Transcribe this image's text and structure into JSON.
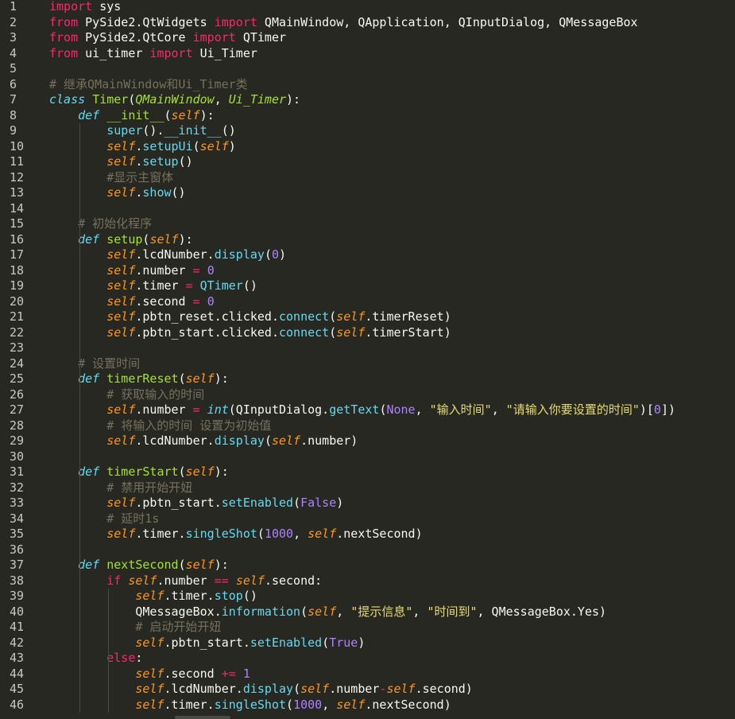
{
  "editor": {
    "theme_colors": {
      "background": "#272822",
      "keyword": "#f92672",
      "function": "#a6e22e",
      "builtin": "#66d9ef",
      "self": "#fd971f",
      "number": "#ae81ff",
      "string": "#e6db74",
      "comment": "#75715e"
    },
    "lines": [
      {
        "n": "1",
        "tokens": [
          [
            "kw",
            "import"
          ],
          [
            "plain",
            " sys"
          ]
        ]
      },
      {
        "n": "2",
        "tokens": [
          [
            "kw",
            "from"
          ],
          [
            "plain",
            " PySide2.QtWidgets "
          ],
          [
            "kw",
            "import"
          ],
          [
            "plain",
            " QMainWindow, QApplication, QInputDialog, QMessageBox"
          ]
        ]
      },
      {
        "n": "3",
        "tokens": [
          [
            "kw",
            "from"
          ],
          [
            "plain",
            " PySide2.QtCore "
          ],
          [
            "kw",
            "import"
          ],
          [
            "plain",
            " QTimer"
          ]
        ]
      },
      {
        "n": "4",
        "tokens": [
          [
            "kw",
            "from"
          ],
          [
            "plain",
            " ui_timer "
          ],
          [
            "kw",
            "import"
          ],
          [
            "plain",
            " Ui_Timer"
          ]
        ]
      },
      {
        "n": "5",
        "tokens": []
      },
      {
        "n": "6",
        "tokens": [
          [
            "cmt",
            "# 继承QMainWindow和Ui_Timer类"
          ]
        ]
      },
      {
        "n": "7",
        "tokens": [
          [
            "def",
            "class"
          ],
          [
            "plain",
            " "
          ],
          [
            "fn",
            "Timer"
          ],
          [
            "plain",
            "("
          ],
          [
            "inh",
            "QMainWindow"
          ],
          [
            "plain",
            ", "
          ],
          [
            "inh",
            "Ui_Timer"
          ],
          [
            "plain",
            "):"
          ]
        ]
      },
      {
        "n": "8",
        "tokens": [
          [
            "plain",
            "    "
          ],
          [
            "def",
            "def"
          ],
          [
            "plain",
            " "
          ],
          [
            "fn",
            "__init__"
          ],
          [
            "plain",
            "("
          ],
          [
            "arg",
            "self"
          ],
          [
            "plain",
            "):"
          ]
        ]
      },
      {
        "n": "9",
        "tokens": [
          [
            "plain",
            "        "
          ],
          [
            "call",
            "super"
          ],
          [
            "plain",
            "()."
          ],
          [
            "call",
            "__init__"
          ],
          [
            "plain",
            "()"
          ]
        ]
      },
      {
        "n": "10",
        "tokens": [
          [
            "plain",
            "        "
          ],
          [
            "self",
            "self"
          ],
          [
            "plain",
            "."
          ],
          [
            "call",
            "setupUi"
          ],
          [
            "plain",
            "("
          ],
          [
            "self",
            "self"
          ],
          [
            "plain",
            ")"
          ]
        ]
      },
      {
        "n": "11",
        "tokens": [
          [
            "plain",
            "        "
          ],
          [
            "self",
            "self"
          ],
          [
            "plain",
            "."
          ],
          [
            "call",
            "setup"
          ],
          [
            "plain",
            "()"
          ]
        ]
      },
      {
        "n": "12",
        "tokens": [
          [
            "plain",
            "        "
          ],
          [
            "cmt",
            "#显示主窗体"
          ]
        ]
      },
      {
        "n": "13",
        "tokens": [
          [
            "plain",
            "        "
          ],
          [
            "self",
            "self"
          ],
          [
            "plain",
            "."
          ],
          [
            "call",
            "show"
          ],
          [
            "plain",
            "()"
          ]
        ]
      },
      {
        "n": "14",
        "tokens": []
      },
      {
        "n": "15",
        "tokens": [
          [
            "plain",
            "    "
          ],
          [
            "cmt",
            "# 初始化程序"
          ]
        ]
      },
      {
        "n": "16",
        "tokens": [
          [
            "plain",
            "    "
          ],
          [
            "def",
            "def"
          ],
          [
            "plain",
            " "
          ],
          [
            "fn",
            "setup"
          ],
          [
            "plain",
            "("
          ],
          [
            "arg",
            "self"
          ],
          [
            "plain",
            "):"
          ]
        ]
      },
      {
        "n": "17",
        "tokens": [
          [
            "plain",
            "        "
          ],
          [
            "self",
            "self"
          ],
          [
            "plain",
            ".lcdNumber."
          ],
          [
            "call",
            "display"
          ],
          [
            "plain",
            "("
          ],
          [
            "num",
            "0"
          ],
          [
            "plain",
            ")"
          ]
        ]
      },
      {
        "n": "18",
        "tokens": [
          [
            "plain",
            "        "
          ],
          [
            "self",
            "self"
          ],
          [
            "plain",
            ".number "
          ],
          [
            "op",
            "="
          ],
          [
            "plain",
            " "
          ],
          [
            "num",
            "0"
          ]
        ]
      },
      {
        "n": "19",
        "tokens": [
          [
            "plain",
            "        "
          ],
          [
            "self",
            "self"
          ],
          [
            "plain",
            ".timer "
          ],
          [
            "op",
            "="
          ],
          [
            "plain",
            " "
          ],
          [
            "call",
            "QTimer"
          ],
          [
            "plain",
            "()"
          ]
        ]
      },
      {
        "n": "20",
        "tokens": [
          [
            "plain",
            "        "
          ],
          [
            "self",
            "self"
          ],
          [
            "plain",
            ".second "
          ],
          [
            "op",
            "="
          ],
          [
            "plain",
            " "
          ],
          [
            "num",
            "0"
          ]
        ]
      },
      {
        "n": "21",
        "tokens": [
          [
            "plain",
            "        "
          ],
          [
            "self",
            "self"
          ],
          [
            "plain",
            ".pbtn_reset.clicked."
          ],
          [
            "call",
            "connect"
          ],
          [
            "plain",
            "("
          ],
          [
            "self",
            "self"
          ],
          [
            "plain",
            ".timerReset)"
          ]
        ]
      },
      {
        "n": "22",
        "tokens": [
          [
            "plain",
            "        "
          ],
          [
            "self",
            "self"
          ],
          [
            "plain",
            ".pbtn_start.clicked."
          ],
          [
            "call",
            "connect"
          ],
          [
            "plain",
            "("
          ],
          [
            "self",
            "self"
          ],
          [
            "plain",
            ".timerStart)"
          ]
        ]
      },
      {
        "n": "23",
        "tokens": []
      },
      {
        "n": "24",
        "tokens": [
          [
            "plain",
            "    "
          ],
          [
            "cmt",
            "# 设置时间"
          ]
        ]
      },
      {
        "n": "25",
        "tokens": [
          [
            "plain",
            "    "
          ],
          [
            "def",
            "def"
          ],
          [
            "plain",
            " "
          ],
          [
            "fn",
            "timerReset"
          ],
          [
            "plain",
            "("
          ],
          [
            "arg",
            "self"
          ],
          [
            "plain",
            "):"
          ]
        ]
      },
      {
        "n": "26",
        "tokens": [
          [
            "plain",
            "        "
          ],
          [
            "cmt",
            "# 获取输入的时间"
          ]
        ]
      },
      {
        "n": "27",
        "tokens": [
          [
            "plain",
            "        "
          ],
          [
            "self",
            "self"
          ],
          [
            "plain",
            ".number "
          ],
          [
            "op",
            "="
          ],
          [
            "plain",
            " "
          ],
          [
            "builtin",
            "int"
          ],
          [
            "plain",
            "(QInputDialog."
          ],
          [
            "call",
            "getText"
          ],
          [
            "plain",
            "("
          ],
          [
            "const",
            "None"
          ],
          [
            "plain",
            ", "
          ],
          [
            "str",
            "\"输入时间\""
          ],
          [
            "plain",
            ", "
          ],
          [
            "str",
            "\"请输入你要设置的时间\""
          ],
          [
            "plain",
            ")["
          ],
          [
            "num",
            "0"
          ],
          [
            "plain",
            "])"
          ]
        ]
      },
      {
        "n": "28",
        "tokens": [
          [
            "plain",
            "        "
          ],
          [
            "cmt",
            "# 将输入的时间 设置为初始值"
          ]
        ]
      },
      {
        "n": "29",
        "tokens": [
          [
            "plain",
            "        "
          ],
          [
            "self",
            "self"
          ],
          [
            "plain",
            ".lcdNumber."
          ],
          [
            "call",
            "display"
          ],
          [
            "plain",
            "("
          ],
          [
            "self",
            "self"
          ],
          [
            "plain",
            ".number)"
          ]
        ]
      },
      {
        "n": "30",
        "tokens": []
      },
      {
        "n": "31",
        "tokens": [
          [
            "plain",
            "    "
          ],
          [
            "def",
            "def"
          ],
          [
            "plain",
            " "
          ],
          [
            "fn",
            "timerStart"
          ],
          [
            "plain",
            "("
          ],
          [
            "arg",
            "self"
          ],
          [
            "plain",
            "):"
          ]
        ]
      },
      {
        "n": "32",
        "tokens": [
          [
            "plain",
            "        "
          ],
          [
            "cmt",
            "# 禁用开始开妞"
          ]
        ]
      },
      {
        "n": "33",
        "tokens": [
          [
            "plain",
            "        "
          ],
          [
            "self",
            "self"
          ],
          [
            "plain",
            ".pbtn_start."
          ],
          [
            "call",
            "setEnabled"
          ],
          [
            "plain",
            "("
          ],
          [
            "const",
            "False"
          ],
          [
            "plain",
            ")"
          ]
        ]
      },
      {
        "n": "34",
        "tokens": [
          [
            "plain",
            "        "
          ],
          [
            "cmt",
            "# 延时1s"
          ]
        ]
      },
      {
        "n": "35",
        "tokens": [
          [
            "plain",
            "        "
          ],
          [
            "self",
            "self"
          ],
          [
            "plain",
            ".timer."
          ],
          [
            "call",
            "singleShot"
          ],
          [
            "plain",
            "("
          ],
          [
            "num",
            "1000"
          ],
          [
            "plain",
            ", "
          ],
          [
            "self",
            "self"
          ],
          [
            "plain",
            ".nextSecond)"
          ]
        ]
      },
      {
        "n": "36",
        "tokens": []
      },
      {
        "n": "37",
        "tokens": [
          [
            "plain",
            "    "
          ],
          [
            "def",
            "def"
          ],
          [
            "plain",
            " "
          ],
          [
            "fn",
            "nextSecond"
          ],
          [
            "plain",
            "("
          ],
          [
            "arg",
            "self"
          ],
          [
            "plain",
            "):"
          ]
        ]
      },
      {
        "n": "38",
        "tokens": [
          [
            "plain",
            "        "
          ],
          [
            "kw",
            "if"
          ],
          [
            "plain",
            " "
          ],
          [
            "self",
            "self"
          ],
          [
            "plain",
            ".number "
          ],
          [
            "op",
            "=="
          ],
          [
            "plain",
            " "
          ],
          [
            "self",
            "self"
          ],
          [
            "plain",
            ".second:"
          ]
        ]
      },
      {
        "n": "39",
        "tokens": [
          [
            "plain",
            "            "
          ],
          [
            "self",
            "self"
          ],
          [
            "plain",
            ".timer."
          ],
          [
            "call",
            "stop"
          ],
          [
            "plain",
            "()"
          ]
        ]
      },
      {
        "n": "40",
        "tokens": [
          [
            "plain",
            "            QMessageBox."
          ],
          [
            "call",
            "information"
          ],
          [
            "plain",
            "("
          ],
          [
            "self",
            "self"
          ],
          [
            "plain",
            ", "
          ],
          [
            "str",
            "\"提示信息\""
          ],
          [
            "plain",
            ", "
          ],
          [
            "str",
            "\"时间到\""
          ],
          [
            "plain",
            ", QMessageBox.Yes)"
          ]
        ]
      },
      {
        "n": "41",
        "tokens": [
          [
            "plain",
            "            "
          ],
          [
            "cmt",
            "# 启动开始开妞"
          ]
        ]
      },
      {
        "n": "42",
        "tokens": [
          [
            "plain",
            "            "
          ],
          [
            "self",
            "self"
          ],
          [
            "plain",
            ".pbtn_start."
          ],
          [
            "call",
            "setEnabled"
          ],
          [
            "plain",
            "("
          ],
          [
            "const",
            "True"
          ],
          [
            "plain",
            ")"
          ]
        ]
      },
      {
        "n": "43",
        "tokens": [
          [
            "plain",
            "        "
          ],
          [
            "kw",
            "else"
          ],
          [
            "plain",
            ":"
          ]
        ]
      },
      {
        "n": "44",
        "tokens": [
          [
            "plain",
            "            "
          ],
          [
            "self",
            "self"
          ],
          [
            "plain",
            ".second "
          ],
          [
            "op",
            "+="
          ],
          [
            "plain",
            " "
          ],
          [
            "num",
            "1"
          ]
        ]
      },
      {
        "n": "45",
        "tokens": [
          [
            "plain",
            "            "
          ],
          [
            "self",
            "self"
          ],
          [
            "plain",
            ".lcdNumber."
          ],
          [
            "call",
            "display"
          ],
          [
            "plain",
            "("
          ],
          [
            "self",
            "self"
          ],
          [
            "plain",
            ".number"
          ],
          [
            "op",
            "-"
          ],
          [
            "self",
            "self"
          ],
          [
            "plain",
            ".second)"
          ]
        ]
      },
      {
        "n": "46",
        "tokens": [
          [
            "plain",
            "            "
          ],
          [
            "self",
            "self"
          ],
          [
            "plain",
            ".timer."
          ],
          [
            "call",
            "singleShot"
          ],
          [
            "plain",
            "("
          ],
          [
            "num",
            "1000"
          ],
          [
            "plain",
            ", "
          ],
          [
            "self",
            "self"
          ],
          [
            "plain",
            ".nextSecond)"
          ]
        ]
      }
    ]
  }
}
